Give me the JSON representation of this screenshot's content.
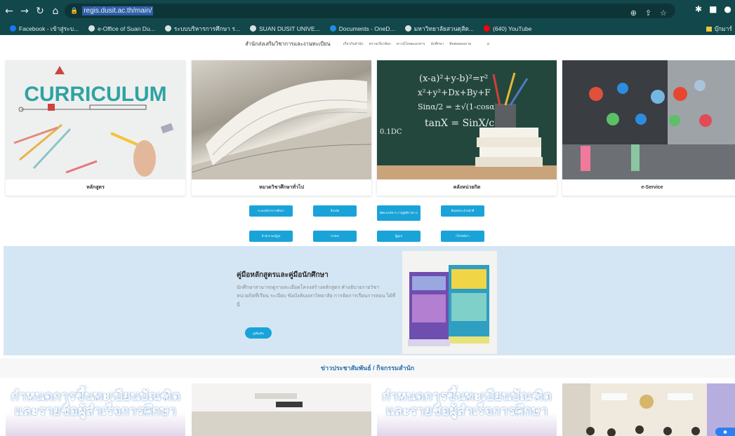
{
  "browser": {
    "url": "regis.dusit.ac.th/main/",
    "bookmarks": [
      {
        "label": "Facebook - เข้าสู่ระบ...",
        "color": "#1877f2"
      },
      {
        "label": "e-Office of Suan Du...",
        "color": "#d9e2e2"
      },
      {
        "label": "ระบบบริหารการศึกษา ร...",
        "color": "#d9e2e2"
      },
      {
        "label": "SUAN DUSIT UNIVE...",
        "color": "#d9e2e2"
      },
      {
        "label": "Documents - OneD...",
        "color": "#1d8fe0"
      },
      {
        "label": "มหาวิทยาลัยสวนดุสิต...",
        "color": "#d9e2e2"
      },
      {
        "label": "(640) YouTube",
        "color": "#ff0000"
      }
    ],
    "bookmark_right": "บุ๊กมาร์"
  },
  "site": {
    "title": "สำนักส่งเสริมวิชาการและงานทะเบียน",
    "links": [
      "เกี่ยวกับสำนัก",
      "ตรวจเกี่ยวข้อง",
      "ดาวน์โหลดเอกสาร",
      "นักศึกษา",
      "ติดต่อสอบถาม"
    ]
  },
  "cards": [
    {
      "caption": "หลักสูตร",
      "image_text": "CURRICULUM"
    },
    {
      "caption": "หมวดวิชาศึกษาทั่วไป"
    },
    {
      "caption": "คลังหน่วยกิต"
    },
    {
      "caption": "e-Service"
    }
  ],
  "quick_buttons": [
    [
      "ระบบบริหารการศึกษา",
      "ลืมรหัส",
      "ทิศทางบริหาร ภาปฏิบัติราชการ",
      "ติดต่อกับ เจ้าหน้าที่"
    ],
    [
      "สำนักงานปฏิรูป",
      "FORM",
      "ผู้ดูแล",
      "เว็บไซต์เก่า"
    ]
  ],
  "handbook": {
    "title": "คู่มือหลักสูตรและคู่มือนักศึกษา",
    "description": "นักศึกษาสามารถดูรายละเอียดโครงสร้างหลักสูตร คำอธิบายรายวิชา หน่วยกิตที่เรียน ระเบียบ ข้อบังคับมหาวิทยาลัย การจัดการเรียนการสอน ได้ที่นี่",
    "button": "ดูเพิ่มเติม"
  },
  "news": {
    "heading": "ข่าวประชาสัมพันธ์ / กิจกรรมสำนัก",
    "banner_text": "กำหนดการขึ้นทะเบียนบัณฑิต และรายชื่อผู้สำเร็จการศึกษา"
  }
}
